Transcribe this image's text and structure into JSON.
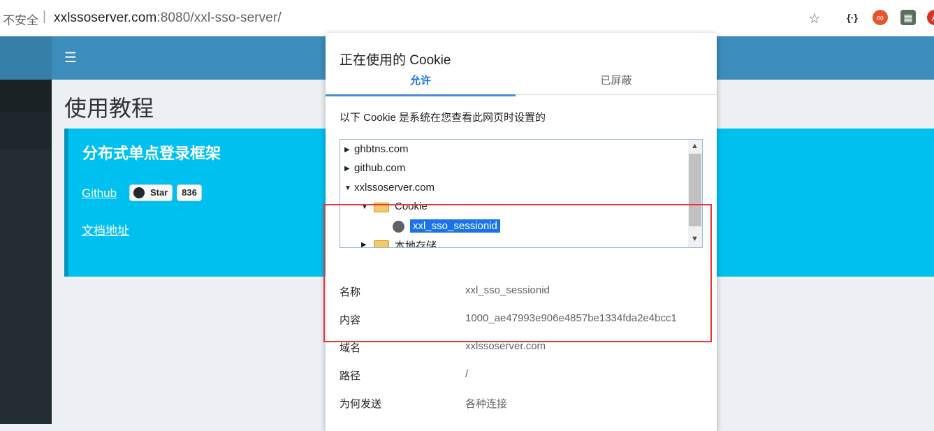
{
  "browser": {
    "insecure_label": "不安全",
    "separator": "|",
    "url_host": "xxlssoserver.com",
    "url_rest": ":8080/xxl-sso-server/",
    "star_icon": "☆",
    "ext_icons": [
      "{·}",
      "∞",
      "▦",
      "A"
    ]
  },
  "page": {
    "hamburger_icon": "☰",
    "title": "使用教程",
    "callout_title": "分布式单点登录框架",
    "github_link": "Github",
    "star_label": "Star",
    "star_count": "836",
    "doc_link": "文档地址"
  },
  "dialog": {
    "title": "正在使用的 Cookie",
    "tabs": {
      "allowed": "允许",
      "blocked": "已屏蔽"
    },
    "description": "以下 Cookie 是系统在您查看此网页时设置的",
    "tree": {
      "items": [
        "ghbtns.com",
        "github.com",
        "xxlssoserver.com"
      ],
      "folder_cookie": "Cookie",
      "selected_cookie": "xxl_sso_sessionid",
      "folder_storage": "本地存储"
    },
    "details": {
      "name_label": "名称",
      "name_value": "xxl_sso_sessionid",
      "content_label": "内容",
      "content_value": "1000_ae47993e906e4857be1334fda2e4bcc1",
      "domain_label": "域名",
      "domain_value": "xxlssoserver.com",
      "path_label": "路径",
      "path_value": "/",
      "send_label": "为何发送",
      "send_value": "各种连接"
    }
  },
  "colors": {
    "header": "#3c8dbc",
    "callout": "#00c0ef",
    "sidebar": "#222d32",
    "highlight": "#e53935",
    "tab_active": "#1a73e8"
  }
}
